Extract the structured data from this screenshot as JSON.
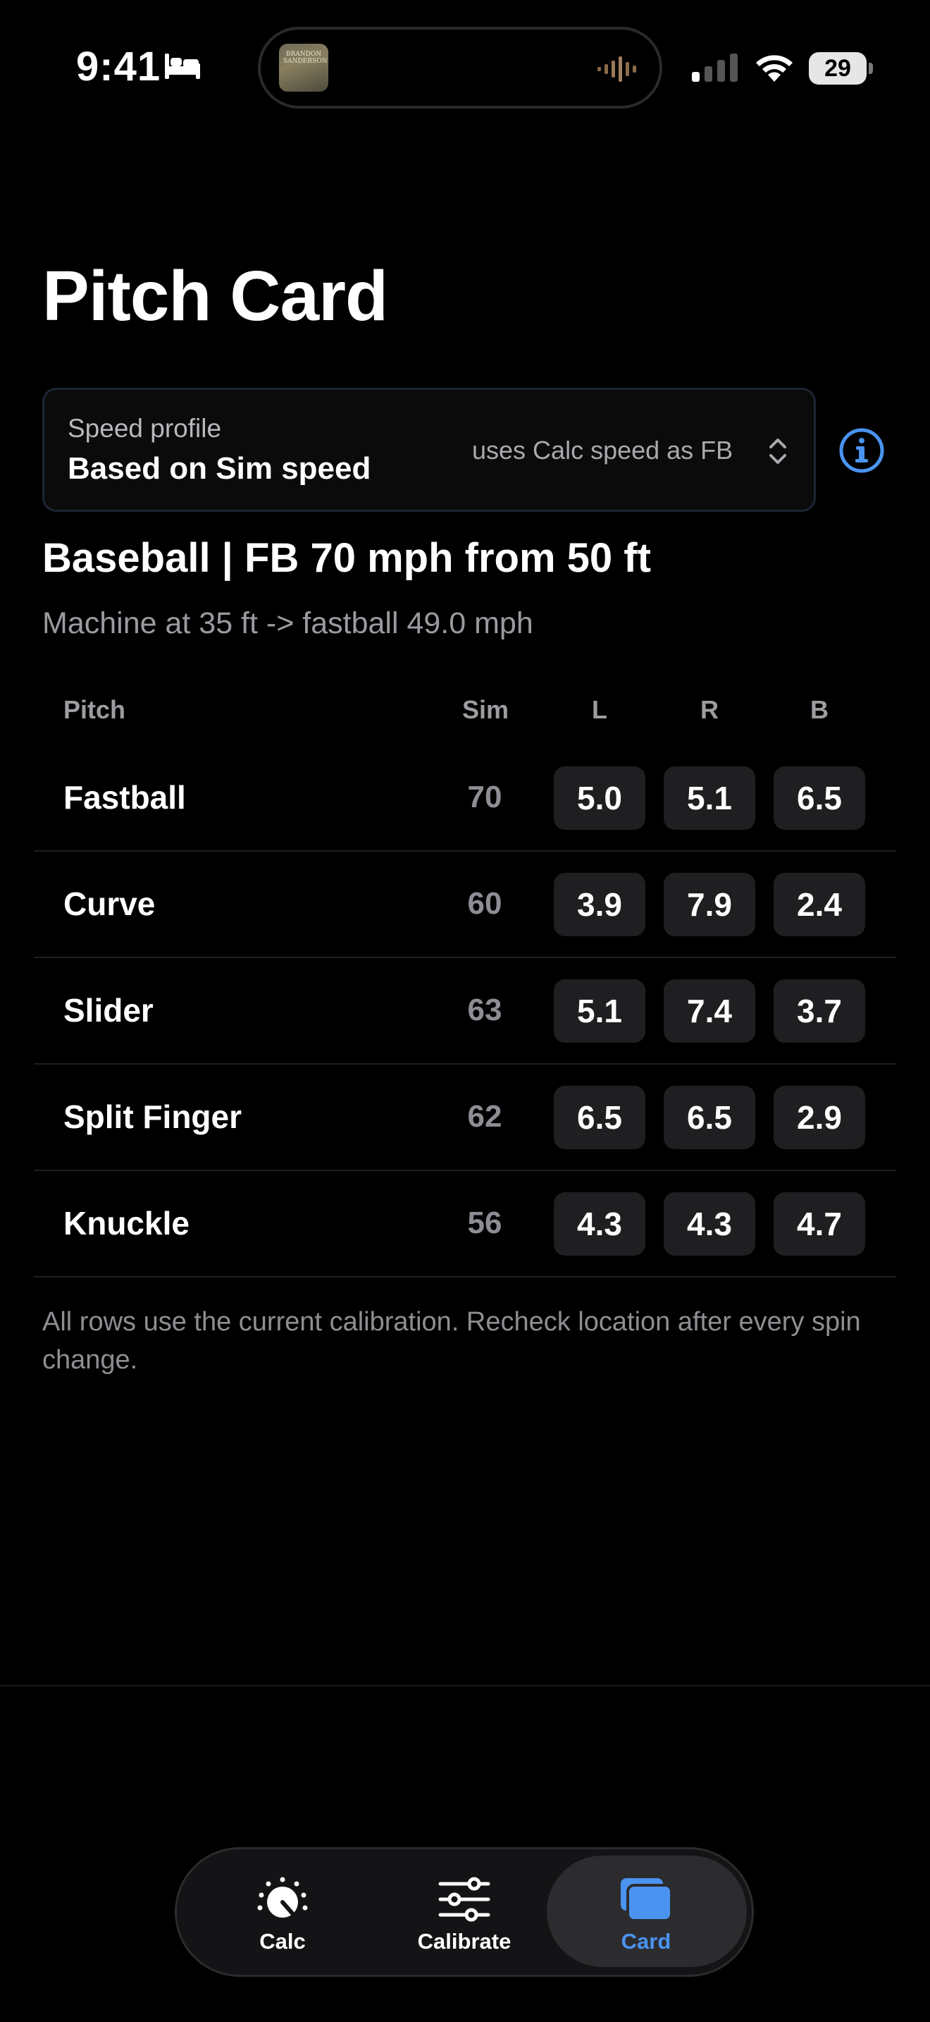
{
  "status_bar": {
    "time": "9:41",
    "now_playing_art_text": "BRANDON SANDERSON",
    "battery": "29",
    "icons": [
      "bed-icon",
      "waveform-icon",
      "cellular-signal-icon",
      "wifi-icon",
      "battery-icon"
    ]
  },
  "page": {
    "title": "Pitch Card"
  },
  "speed_profile": {
    "label": "Speed profile",
    "value": "Based on Sim speed",
    "note": "uses Calc speed as FB",
    "icons": [
      "chevron-up-down-icon",
      "info-icon"
    ]
  },
  "summary": {
    "headline": "Baseball | FB 70 mph from 50 ft",
    "detail": "Machine at 35 ft -> fastball 49.0 mph"
  },
  "table": {
    "headers": {
      "pitch": "Pitch",
      "sim": "Sim",
      "l": "L",
      "r": "R",
      "b": "B"
    },
    "rows": [
      {
        "pitch": "Fastball",
        "sim": "70",
        "l": "5.0",
        "r": "5.1",
        "b": "6.5"
      },
      {
        "pitch": "Curve",
        "sim": "60",
        "l": "3.9",
        "r": "7.9",
        "b": "2.4"
      },
      {
        "pitch": "Slider",
        "sim": "63",
        "l": "5.1",
        "r": "7.4",
        "b": "3.7"
      },
      {
        "pitch": "Split Finger",
        "sim": "62",
        "l": "6.5",
        "r": "6.5",
        "b": "2.9"
      },
      {
        "pitch": "Knuckle",
        "sim": "56",
        "l": "4.3",
        "r": "4.3",
        "b": "4.7"
      }
    ]
  },
  "footnote": "All rows use the current calibration. Recheck location after every spin change.",
  "tab_bar": {
    "tabs": [
      {
        "label": "Calc",
        "icon": "gauge-icon",
        "selected": false
      },
      {
        "label": "Calibrate",
        "icon": "sliders-icon",
        "selected": false
      },
      {
        "label": "Card",
        "icon": "cards-icon",
        "selected": true
      }
    ]
  },
  "colors": {
    "background": "#000000",
    "accent": "#4A93F0",
    "chip": "#1F1F22",
    "muted_text": "#8E8E93"
  }
}
